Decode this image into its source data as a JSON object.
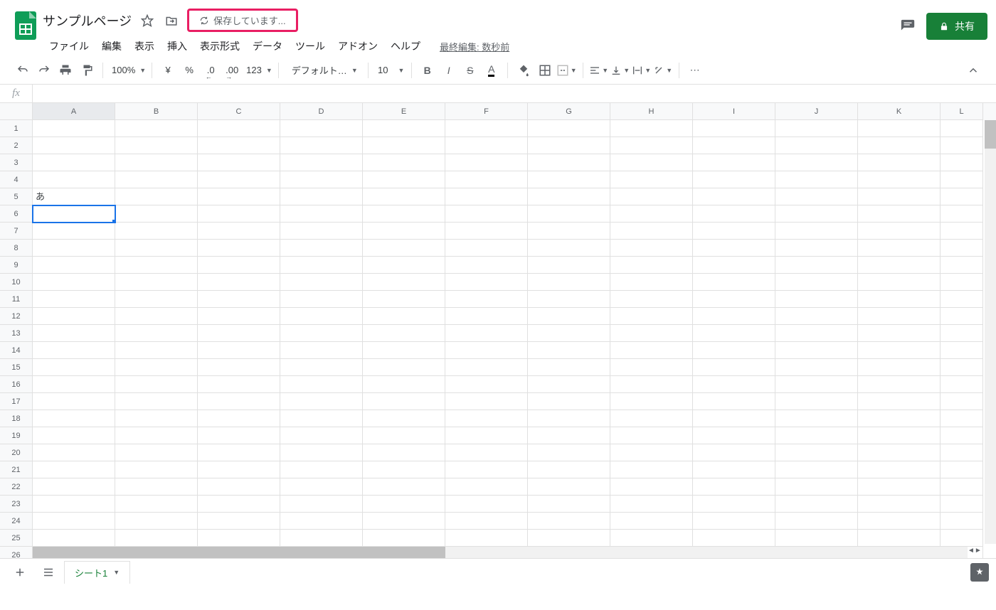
{
  "header": {
    "doc_title": "サンプルページ",
    "saving_text": "保存しています...",
    "last_edit": "最終編集: 数秒前",
    "share_label": "共有"
  },
  "menu": [
    "ファイル",
    "編集",
    "表示",
    "挿入",
    "表示形式",
    "データ",
    "ツール",
    "アドオン",
    "ヘルプ"
  ],
  "toolbar": {
    "zoom": "100%",
    "currency_symbol": "¥",
    "percent_symbol": "%",
    "dec_dec": ".0",
    "inc_dec": ".00",
    "format_123": "123",
    "font_name": "デフォルト…",
    "font_size": "10"
  },
  "columns": [
    "A",
    "B",
    "C",
    "D",
    "E",
    "F",
    "G",
    "H",
    "I",
    "J",
    "K",
    "L"
  ],
  "row_count": 26,
  "selected_cell": "A6",
  "cells": {
    "A5": "あ"
  },
  "sheet_tab": "シート1",
  "formula_value": ""
}
